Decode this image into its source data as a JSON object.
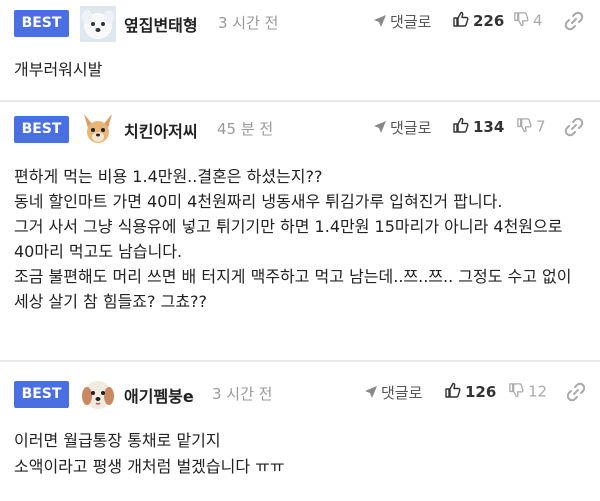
{
  "comments": [
    {
      "badge": "BEST",
      "nickname": "옆집변태형",
      "time": "3 시간 전",
      "reply_label": "댓글로",
      "likes": "226",
      "dislikes": "4",
      "avatar": "white-puppy-avatar",
      "body": "개부러워시발"
    },
    {
      "badge": "BEST",
      "nickname": "치킨아저씨",
      "time": "45 분 전",
      "reply_label": "댓글로",
      "likes": "134",
      "dislikes": "7",
      "avatar": "chihuahua-avatar",
      "body": "편하게 먹는 비용 1.4만원..결혼은 하셨는지??\n동네 할인마트 가면 40미 4천원짜리 냉동새우 튀김가루 입혀진거 팝니다.\n그거 사서 그냥 식용유에 넣고 튀기기만 하면 1.4만원 15마리가 아니라 4천원으로 40마리 먹고도 남습니다.\n조금 불편해도 머리 쓰면 배 터지게 맥주하고 먹고 남는데..쯔..쯔.. 그정도 수고 없이 세상 살기 참 힘들죠? 그쵸??"
    },
    {
      "badge": "BEST",
      "nickname": "애기펨붕e",
      "time": "3 시간 전",
      "reply_label": "댓글로",
      "likes": "126",
      "dislikes": "12",
      "avatar": "fluffy-dog-avatar",
      "body": "이러면 월급통장 통채로 맡기지\n소액이라고 평생 개처럼 벌겠습니다 ㅠㅠ"
    }
  ],
  "colors": {
    "badge": "#4a6fe3",
    "divider": "#e9e9e9",
    "muted": "#9a9a9a"
  }
}
